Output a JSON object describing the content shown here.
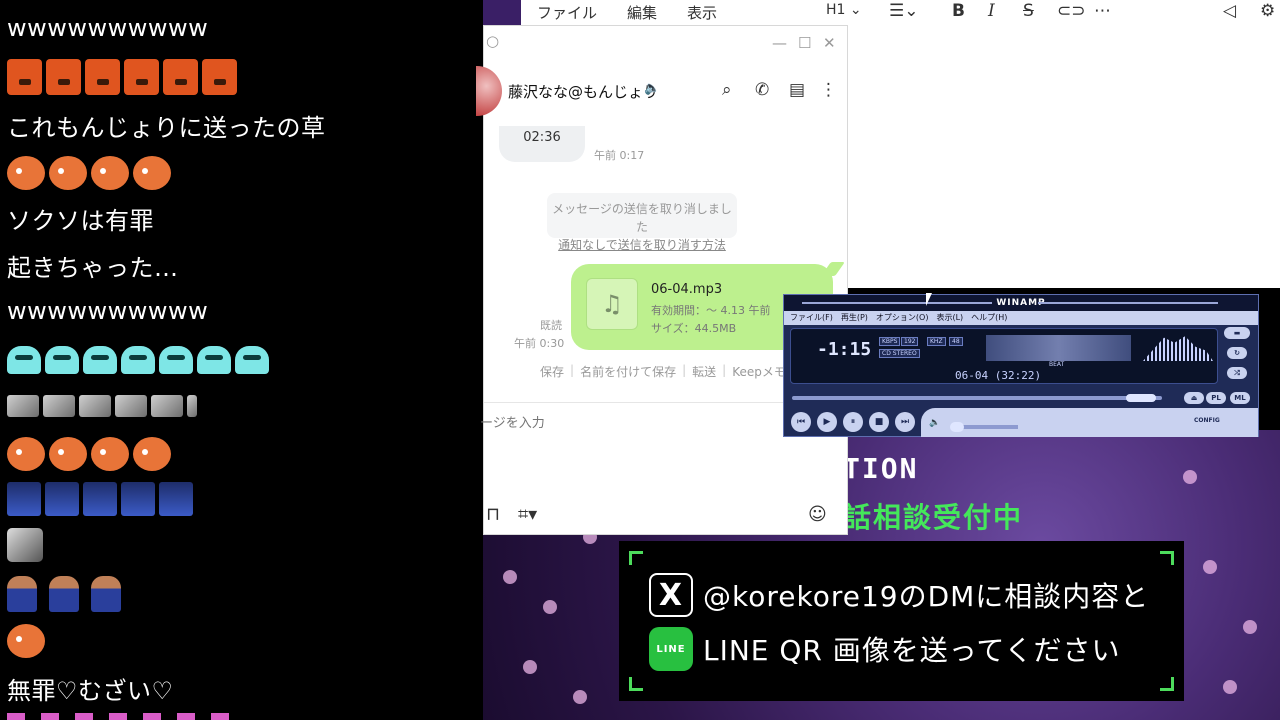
{
  "chat": {
    "messages": [
      "wwwwwwwwww",
      "これもんじょりに送ったの草",
      "ソクソは有罪",
      "起きちゃった…",
      "wwwwwwwwww",
      "無罪♡むざい♡"
    ]
  },
  "editor": {
    "menus": [
      "ファイル",
      "編集",
      "表示"
    ],
    "heading": "H1"
  },
  "line": {
    "contact_name": "藤沢なな@もんじょり",
    "prev_bubble": "02:36",
    "prev_time": "午前 0:17",
    "system_msg": "メッセージの送信を取り消しました",
    "system_link": "通知なしで送信を取り消す方法",
    "file": {
      "name": "06-04.mp3",
      "expiry": "有効期間：～ 4.13 午前",
      "size": "サイズ：44.5MB"
    },
    "read_label": "既読",
    "read_time": "午前 0:30",
    "actions": [
      "保存",
      "名前を付けて保存",
      "転送",
      "Keepメモ"
    ],
    "input_placeholder": "ージを入力"
  },
  "winamp": {
    "title": "WINAMP",
    "menu": [
      "ファイル(F)",
      "再生(P)",
      "オプション(O)",
      "表示(L)",
      "ヘルプ(H)"
    ],
    "time": "-1:15",
    "kbps_label": "KBPS",
    "kbps": "192",
    "khz_label": "KHZ",
    "khz": "48",
    "mode": "CD STEREO",
    "track": "06-04 (32:22)",
    "beat_label": "BEAT",
    "pl_label": "PL",
    "ml_label": "ML",
    "config_label": "CONFIG"
  },
  "stream": {
    "banner_partial": "TION",
    "banner_sub": "話相談受付中",
    "notice_line1": "@korekore19のDMに相談内容と",
    "notice_line2": "LINE QR 画像を送ってください",
    "line_logo_text": "LINE",
    "x_logo_text": "X"
  }
}
